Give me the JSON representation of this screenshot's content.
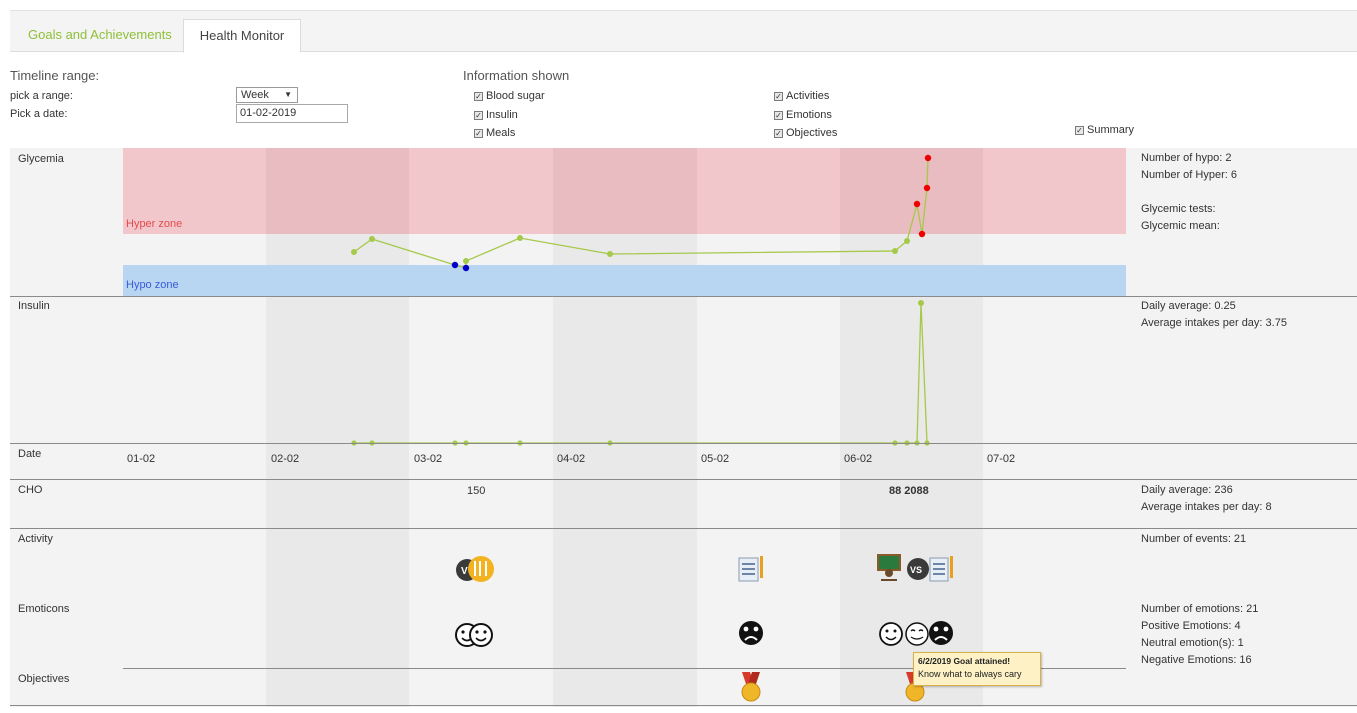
{
  "tabs": [
    {
      "label": "Goals and Achievements"
    },
    {
      "label": "Health Monitor"
    }
  ],
  "controls": {
    "timeline_range_title": "Timeline range:",
    "pick_range_label": "pick a range:",
    "range_value": "Week",
    "pick_date_label": "Pick a date:",
    "date_value": "01-02-2019",
    "info_title": "Information shown",
    "checkboxes": {
      "blood_sugar": "Blood sugar",
      "insulin": "Insulin",
      "meals": "Meals",
      "activities": "Activities",
      "emotions": "Emotions",
      "objectives": "Objectives",
      "summary": "Summary"
    }
  },
  "rows": {
    "glycemia": "Glycemia",
    "insulin": "Insulin",
    "date": "Date",
    "cho": "CHO",
    "activity": "Activity",
    "emoticons": "Emoticons",
    "objectives": "Objectives"
  },
  "zones": {
    "hyper": "Hyper zone",
    "hypo": "Hypo zone"
  },
  "dates": [
    "01-02",
    "02-02",
    "03-02",
    "04-02",
    "05-02",
    "06-02",
    "07-02"
  ],
  "cho_labels": [
    "150",
    "88 2088"
  ],
  "summary": {
    "glycemia": [
      "Number of hypo: 2",
      "Number of Hyper: 6",
      "",
      "Glycemic tests:",
      "Glycemic mean:"
    ],
    "insulin": [
      "Daily average: 0.25",
      "Average intakes per day: 3.75"
    ],
    "cho": [
      "Daily average: 236",
      "Average intakes per day: 8"
    ],
    "activity": [
      "Number of events: 21"
    ],
    "emotions": [
      "Number of emotions: 21",
      "Positive Emotions: 4",
      "Neutral emotion(s): 1",
      "Negative Emotions: 16"
    ]
  },
  "tooltip": {
    "title": "6/2/2019 Goal attained!",
    "text": "Know what to always cary"
  },
  "colors": {
    "accent_green": "#8fbf3a",
    "line": "#a5c94a",
    "hyper_zone": "#f2c7cc",
    "hypo_zone": "#b8d5f2",
    "hyper_point": "#ee0000",
    "hypo_point": "#0000cc"
  },
  "icons": {
    "activity": [
      "vs-icon",
      "food-icon",
      "notepad-icon",
      "school-board-icon",
      "vs-icon",
      "notepad-icon"
    ],
    "emotions": [
      "smiley-icon",
      "smiley-icon",
      "sad-face-icon",
      "smiley-icon",
      "neutral-face-icon",
      "sad-face-icon"
    ],
    "objectives": [
      "medal-icon",
      "medal-icon"
    ]
  }
}
